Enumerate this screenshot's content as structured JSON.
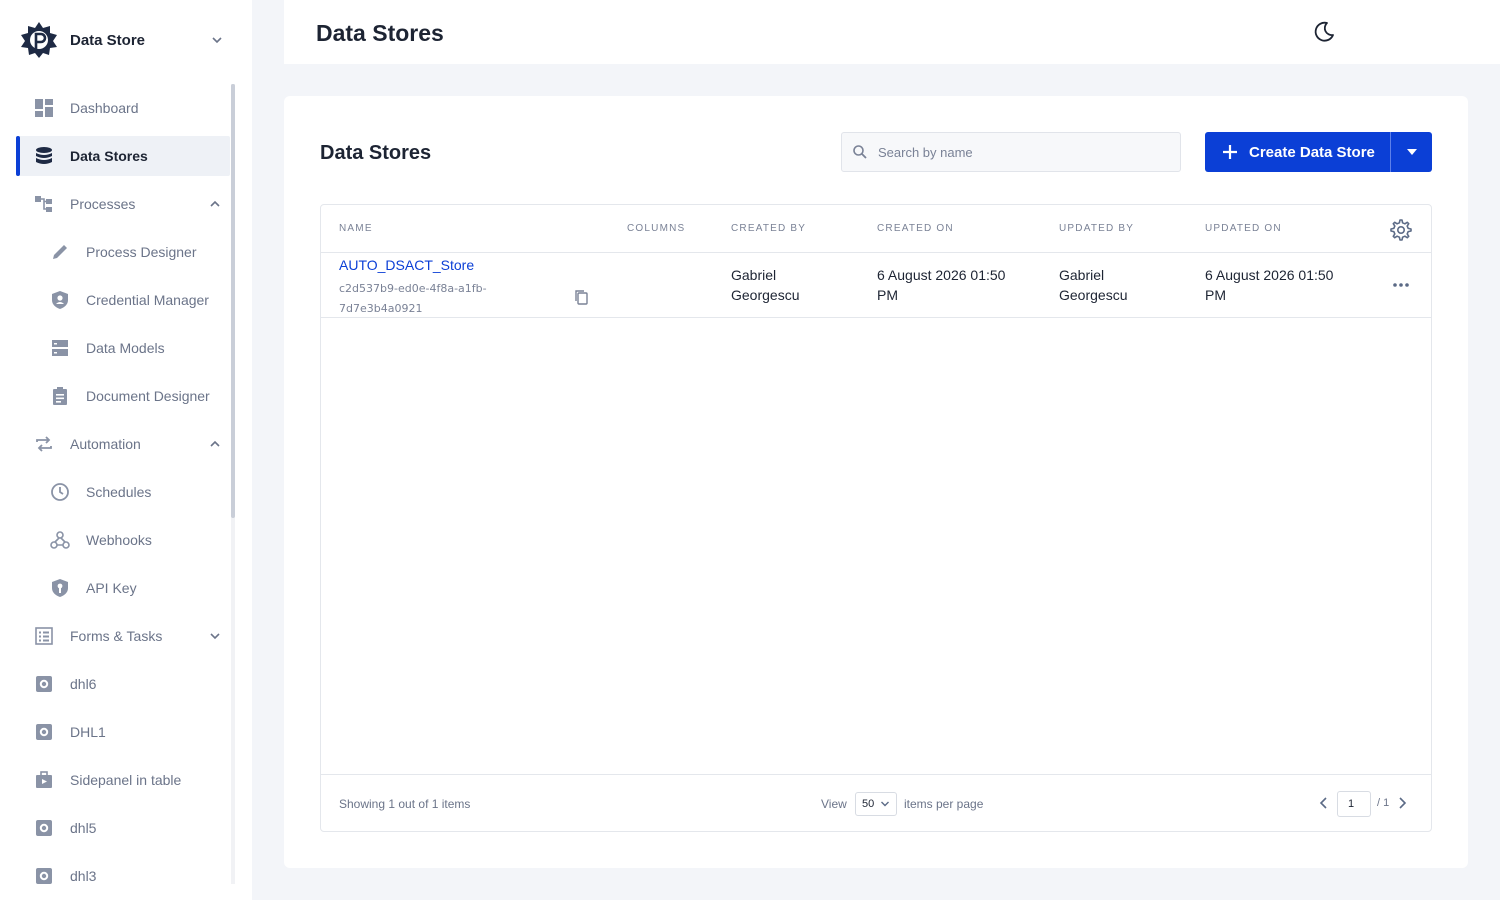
{
  "app": {
    "name": "Data Store"
  },
  "sidebar": {
    "items": [
      {
        "label": "Dashboard",
        "icon": "dashboard-icon",
        "sub": false
      },
      {
        "label": "Data Stores",
        "icon": "database-icon",
        "sub": false,
        "active": true
      },
      {
        "label": "Processes",
        "icon": "processes-icon",
        "sub": false,
        "expanded": true
      },
      {
        "label": "Process Designer",
        "icon": "pencil-icon",
        "sub": true
      },
      {
        "label": "Credential Manager",
        "icon": "shield-user-icon",
        "sub": true
      },
      {
        "label": "Data Models",
        "icon": "server-icon",
        "sub": true
      },
      {
        "label": "Document Designer",
        "icon": "clipboard-icon",
        "sub": true
      },
      {
        "label": "Automation",
        "icon": "repeat-icon",
        "sub": false,
        "expanded": true
      },
      {
        "label": "Schedules",
        "icon": "clock-icon",
        "sub": true
      },
      {
        "label": "Webhooks",
        "icon": "webhook-icon",
        "sub": true
      },
      {
        "label": "API Key",
        "icon": "shield-key-icon",
        "sub": true
      },
      {
        "label": "Forms & Tasks",
        "icon": "list-icon",
        "sub": false,
        "expanded": false
      },
      {
        "label": "dhl6",
        "icon": "app-gear-icon",
        "sub": false
      },
      {
        "label": "DHL1",
        "icon": "app-gear-icon",
        "sub": false
      },
      {
        "label": "Sidepanel in table",
        "icon": "briefcase-icon",
        "sub": false
      },
      {
        "label": "dhl5",
        "icon": "app-gear-icon",
        "sub": false
      },
      {
        "label": "dhl3",
        "icon": "app-gear-icon",
        "sub": false
      }
    ]
  },
  "header": {
    "title": "Data Stores"
  },
  "main": {
    "title": "Data Stores",
    "search": {
      "placeholder": "Search by name",
      "value": ""
    },
    "create_label": "Create Data Store",
    "table": {
      "columns": [
        "Name",
        "Columns",
        "Created By",
        "Created On",
        "Updated By",
        "Updated On"
      ],
      "rows": [
        {
          "name": "AUTO_DSACT_Store",
          "id_line1": "c2d537b9-ed0e-4f8a-a1fb-",
          "id_line2": "7d7e3b4a0921",
          "columns": "",
          "created_by_1": "Gabriel",
          "created_by_2": "Georgescu",
          "created_on_1": "6 August 2026 01:50",
          "created_on_2": "PM",
          "updated_by_1": "Gabriel",
          "updated_by_2": "Georgescu",
          "updated_on_1": "6 August 2026 01:50",
          "updated_on_2": "PM"
        }
      ]
    },
    "footer": {
      "showing": "Showing 1 out of 1 items",
      "view_label": "View",
      "per_page": "50",
      "items_label": "items per page",
      "page": "1",
      "total": "/ 1"
    }
  },
  "colors": {
    "accent": "#0b3fd6",
    "text": "#1d2433",
    "muted": "#6b7489",
    "background": "#f3f5f9"
  }
}
